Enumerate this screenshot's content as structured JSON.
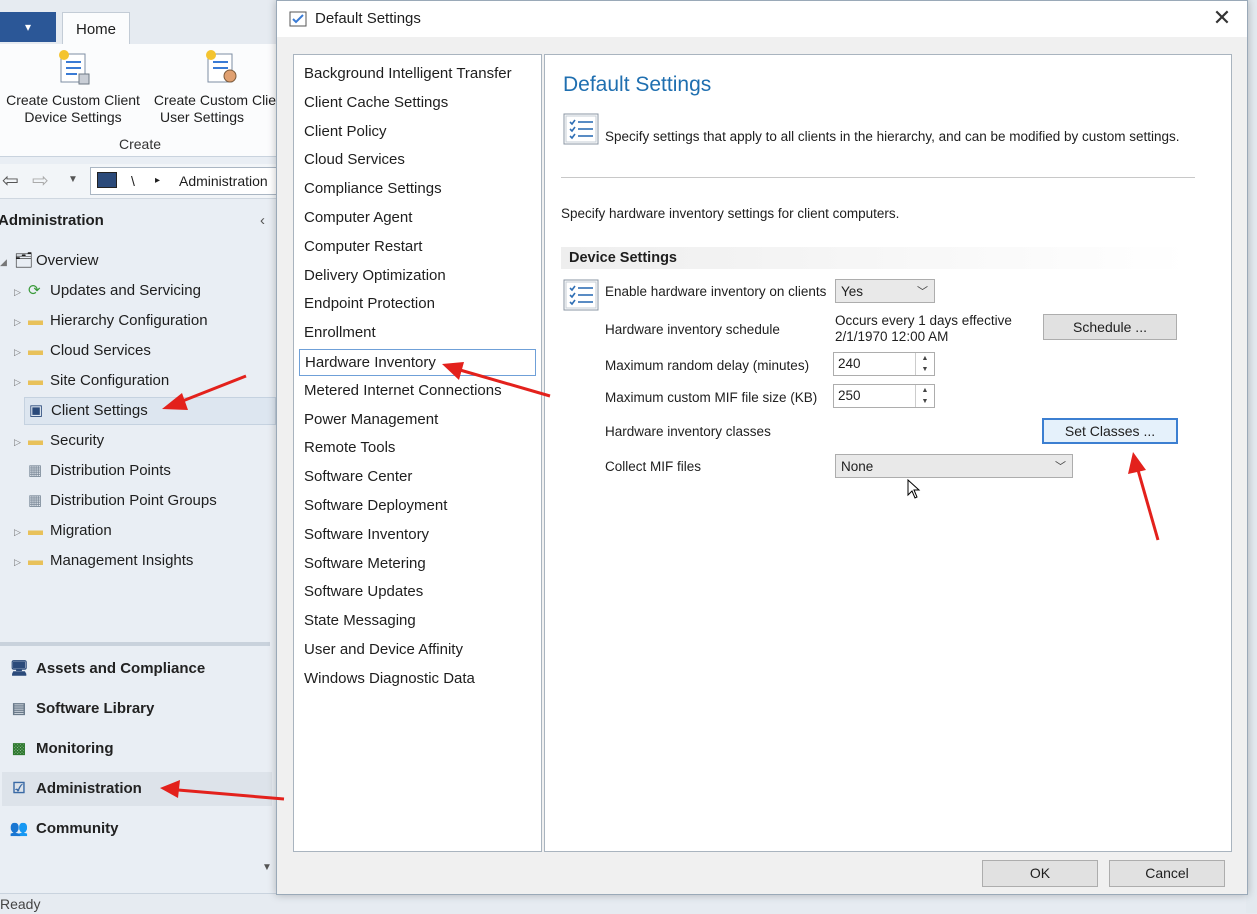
{
  "ribbon": {
    "file_label": "▾",
    "home_tab": "Home",
    "buttons": [
      {
        "line1": "Create Custom Client",
        "line2": "Device Settings"
      },
      {
        "line1": "Create Custom Clie",
        "line2": "User Settings"
      }
    ],
    "group_label": "Create"
  },
  "nav": {
    "path_sep": "\\",
    "path_arrow": "▸",
    "path_text": "Administration"
  },
  "workspace": {
    "header": "Administration",
    "collapse": "‹",
    "tree": [
      {
        "label": "Overview"
      },
      {
        "label": "Updates and Servicing"
      },
      {
        "label": "Hierarchy Configuration"
      },
      {
        "label": "Cloud Services"
      },
      {
        "label": "Site Configuration"
      },
      {
        "label": "Client Settings"
      },
      {
        "label": "Security"
      },
      {
        "label": "Distribution Points"
      },
      {
        "label": "Distribution Point Groups"
      },
      {
        "label": "Migration"
      },
      {
        "label": "Management Insights"
      }
    ],
    "workspaces": [
      {
        "label": "Assets and Compliance"
      },
      {
        "label": "Software Library"
      },
      {
        "label": "Monitoring"
      },
      {
        "label": "Administration"
      },
      {
        "label": "Community"
      }
    ]
  },
  "status": {
    "text": "Ready"
  },
  "dialog": {
    "title": "Default Settings",
    "close": "✕",
    "categories": [
      "Background Intelligent Transfer",
      "Client Cache Settings",
      "Client Policy",
      "Cloud Services",
      "Compliance Settings",
      "Computer Agent",
      "Computer Restart",
      "Delivery Optimization",
      "Endpoint Protection",
      "Enrollment",
      "Hardware Inventory",
      "Metered Internet Connections",
      "Power Management",
      "Remote Tools",
      "Software Center",
      "Software Deployment",
      "Software Inventory",
      "Software Metering",
      "Software Updates",
      "State Messaging",
      "User and Device Affinity",
      "Windows Diagnostic Data"
    ],
    "selected_category": "Hardware Inventory",
    "content": {
      "title": "Default Settings",
      "description": "Specify settings that apply to all clients in the hierarchy, and can be modified by custom settings.",
      "subtitle": "Specify hardware inventory settings for client computers.",
      "section": "Device Settings",
      "enable_label": "Enable hardware inventory on clients",
      "enable_value": "Yes",
      "schedule_label": "Hardware inventory schedule",
      "schedule_line1": "Occurs every 1 days effective",
      "schedule_line2": "2/1/1970 12:00 AM",
      "schedule_button": "Schedule ...",
      "delay_label": "Maximum random delay (minutes)",
      "delay_value": "240",
      "mif_size_label": "Maximum custom MIF file size (KB)",
      "mif_size_value": "250",
      "classes_label": "Hardware inventory classes",
      "classes_button": "Set Classes ...",
      "collect_label": "Collect MIF files",
      "collect_value": "None"
    },
    "ok": "OK",
    "cancel": "Cancel"
  },
  "colors": {
    "accent": "#1f6fb0",
    "annotation": "#e3211c"
  }
}
